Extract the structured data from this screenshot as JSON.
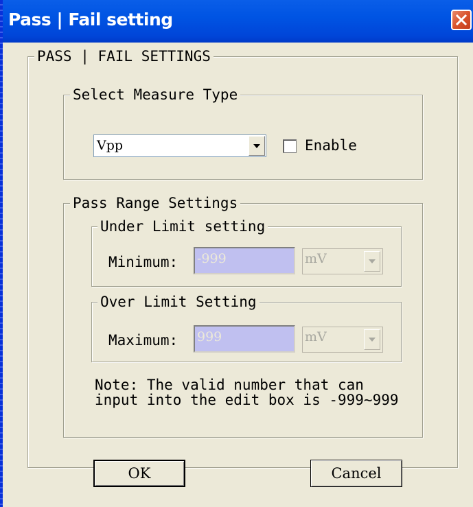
{
  "window": {
    "title": "Pass | Fail setting"
  },
  "main_group": {
    "legend": "PASS | FAIL SETTINGS"
  },
  "measure_group": {
    "legend": "Select Measure Type",
    "measure_type_value": "Vpp",
    "enable_label": "Enable",
    "enable_checked": false
  },
  "range_group": {
    "legend": "Pass Range Settings",
    "under": {
      "legend": "Under Limit setting",
      "label": "Minimum:",
      "value": "-999",
      "unit": "mV"
    },
    "over": {
      "legend": "Over Limit Setting",
      "label": "Maximum:",
      "value": "999",
      "unit": "mV"
    },
    "note": "Note: The valid number that can input into the edit box is -999~999"
  },
  "buttons": {
    "ok": "OK",
    "cancel": "Cancel"
  },
  "icons": {
    "close": "close-icon",
    "dropdown": "chevron-down-icon"
  },
  "colors": {
    "titlebar": "#0054e3",
    "close": "#d9532c",
    "face": "#ece9d8",
    "edit_disabled": "#c0c0f0"
  }
}
